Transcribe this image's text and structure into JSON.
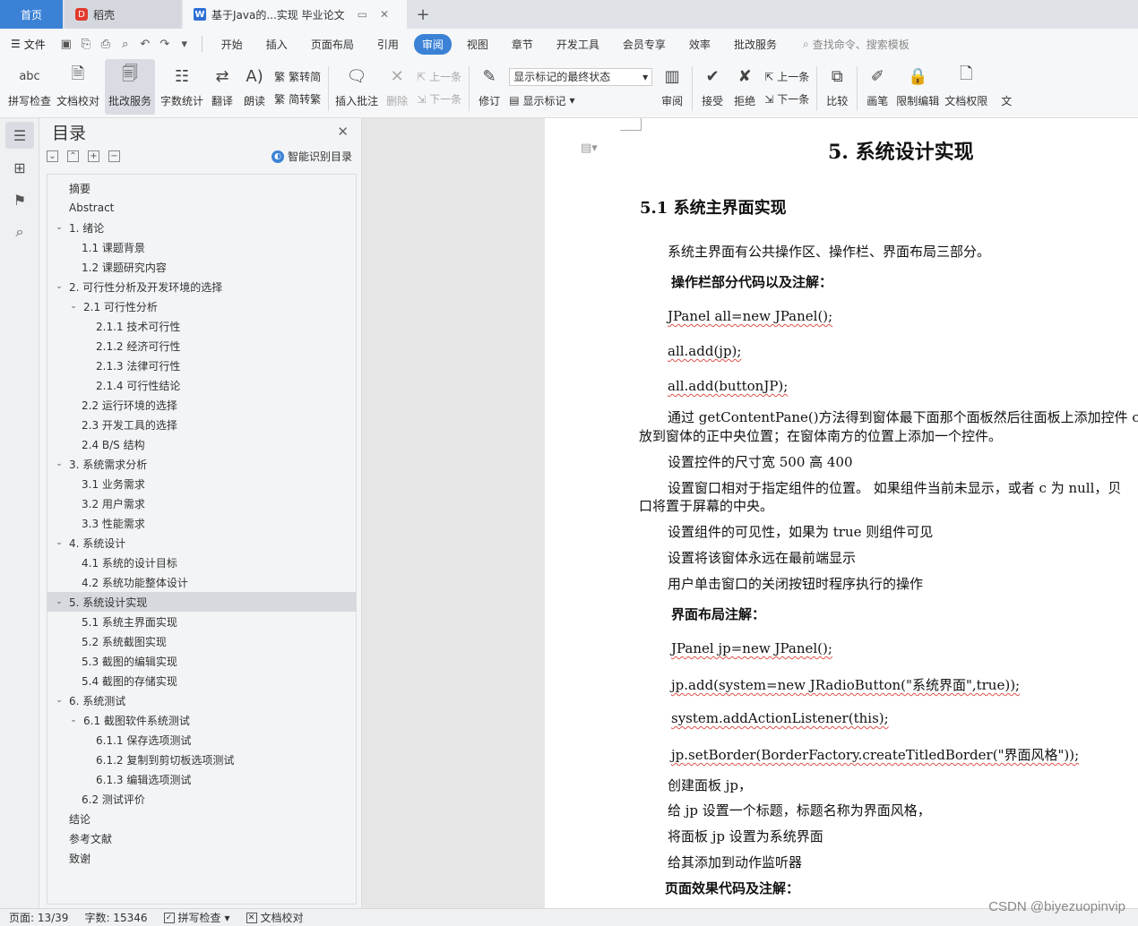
{
  "titlebar": {
    "home_tab": "首页",
    "daoke_tab": "稻壳",
    "doc_tab": "基于Java的...实现   毕业论文",
    "add": "+"
  },
  "menubar": {
    "file": "文件",
    "items": [
      "开始",
      "插入",
      "页面布局",
      "引用",
      "审阅",
      "视图",
      "章节",
      "开发工具",
      "会员专享",
      "效率",
      "批改服务"
    ],
    "active": "审阅",
    "search": "查找命令、搜索模板"
  },
  "ribbon": {
    "spell": "拼写检查",
    "proof": "文档校对",
    "correction": "批改服务",
    "wordcount": "字数统计",
    "translate": "翻译",
    "read": "朗读",
    "trad": "繁转简",
    "simp": "简转繁",
    "insert_comment": "插入批注",
    "delete": "删除",
    "prev": "上一条",
    "next": "下一条",
    "revise": "修订",
    "markup_state": "显示标记的最终状态",
    "show_markup": "显示标记",
    "review": "审阅",
    "accept": "接受",
    "reject": "拒绝",
    "prev2": "上一条",
    "next2": "下一条",
    "compare": "比较",
    "pen": "画笔",
    "restrict": "限制编辑",
    "permission": "文档权限",
    "more": "文"
  },
  "toc": {
    "title": "目录",
    "smart": "智能识别目录",
    "items": [
      {
        "t": "摘要",
        "lv": "l1n",
        "chev": ""
      },
      {
        "t": "Abstract",
        "lv": "l1n",
        "chev": ""
      },
      {
        "t": "1.   绪论",
        "lv": "l1",
        "chev": "v"
      },
      {
        "t": "1.1 课题背景",
        "lv": "l2",
        "chev": ""
      },
      {
        "t": "1.2 课题研究内容",
        "lv": "l2",
        "chev": ""
      },
      {
        "t": "2.  可行性分析及开发环境的选择",
        "lv": "l1",
        "chev": "v"
      },
      {
        "t": "2.1 可行性分析",
        "lv": "l2c",
        "chev": "v"
      },
      {
        "t": "2.1.1 技术可行性",
        "lv": "l3",
        "chev": ""
      },
      {
        "t": "2.1.2 经济可行性",
        "lv": "l3",
        "chev": ""
      },
      {
        "t": "2.1.3 法律可行性",
        "lv": "l3",
        "chev": ""
      },
      {
        "t": "2.1.4 可行性结论",
        "lv": "l3",
        "chev": ""
      },
      {
        "t": "2.2 运行环境的选择",
        "lv": "l2",
        "chev": ""
      },
      {
        "t": "2.3 开发工具的选择",
        "lv": "l2",
        "chev": ""
      },
      {
        "t": "2.4 B/S 结构",
        "lv": "l2",
        "chev": ""
      },
      {
        "t": "3.  系统需求分析",
        "lv": "l1",
        "chev": "v"
      },
      {
        "t": "3.1 业务需求",
        "lv": "l2",
        "chev": ""
      },
      {
        "t": "3.2 用户需求",
        "lv": "l2",
        "chev": ""
      },
      {
        "t": "3.3 性能需求",
        "lv": "l2",
        "chev": ""
      },
      {
        "t": "4.  系统设计",
        "lv": "l1",
        "chev": "v"
      },
      {
        "t": "4.1 系统的设计目标",
        "lv": "l2",
        "chev": ""
      },
      {
        "t": "4.2 系统功能整体设计",
        "lv": "l2",
        "chev": ""
      },
      {
        "t": "5.  系统设计实现",
        "lv": "l1",
        "chev": "v",
        "active": true
      },
      {
        "t": "5.1 系统主界面实现",
        "lv": "l2",
        "chev": ""
      },
      {
        "t": "5.2 系统截图实现",
        "lv": "l2",
        "chev": ""
      },
      {
        "t": "5.3 截图的编辑实现",
        "lv": "l2",
        "chev": ""
      },
      {
        "t": "5.4 截图的存储实现",
        "lv": "l2",
        "chev": ""
      },
      {
        "t": "6.  系统测试",
        "lv": "l1",
        "chev": "v"
      },
      {
        "t": "6.1 截图软件系统测试",
        "lv": "l2c",
        "chev": "v"
      },
      {
        "t": "6.1.1 保存选项测试",
        "lv": "l3",
        "chev": ""
      },
      {
        "t": "6.1.2 复制到剪切板选项测试",
        "lv": "l3",
        "chev": ""
      },
      {
        "t": "6.1.3 编辑选项测试",
        "lv": "l3",
        "chev": ""
      },
      {
        "t": "6.2 测试评价",
        "lv": "l2",
        "chev": ""
      },
      {
        "t": "结论",
        "lv": "l1n",
        "chev": ""
      },
      {
        "t": "参考文献",
        "lv": "l1n",
        "chev": ""
      },
      {
        "t": "致谢",
        "lv": "l1n",
        "chev": ""
      }
    ]
  },
  "doc": {
    "h1": "5.  系统设计实现",
    "h2": "5.1 系统主界面实现",
    "p1": "系统主界面有公共操作区、操作栏、界面布局三部分。",
    "b1": "操作栏部分代码以及注解：",
    "c1": "JPanel all=new JPanel();",
    "c2": "all.add(jp);",
    "c3": "all.add(buttonJP);",
    "p2a": "通过 getContentPane()方法得到窗体最下面那个面板然后往面板上添加控件 c",
    "p2b": "放到窗体的正中央位置；在窗体南方的位置上添加一个控件。",
    "p3": "设置控件的尺寸宽 500 高 400",
    "p4a": "设置窗口相对于指定组件的位置。 如果组件当前未显示，或者  c  为  null，贝",
    "p4b": "口将置于屏幕的中央。",
    "p5": "设置组件的可见性，如果为 true 则组件可见",
    "p6": "设置将该窗体永远在最前端显示",
    "p7": "用户单击窗口的关闭按钮时程序执行的操作",
    "b2": "界面布局注解：",
    "c4": "JPanel jp=new JPanel();",
    "c5": "jp.add(system=new JRadioButton(\"系统界面\",true));",
    "c6": "system.addActionListener(this);",
    "c7": "jp.setBorder(BorderFactory.createTitledBorder(\"界面风格\"));",
    "p8": "创建面板 jp，",
    "p9": "给 jp 设置一个标题，标题名称为界面风格，",
    "p10": "将面板 jp 设置为系统界面",
    "p11": "给其添加到动作监听器",
    "b3": "页面效果代码及注解："
  },
  "status": {
    "page": "页面: 13/39",
    "words": "字数: 15346",
    "spell": "拼写检查",
    "proof": "文档校对"
  },
  "watermark": "CSDN @biyezuopinvip"
}
